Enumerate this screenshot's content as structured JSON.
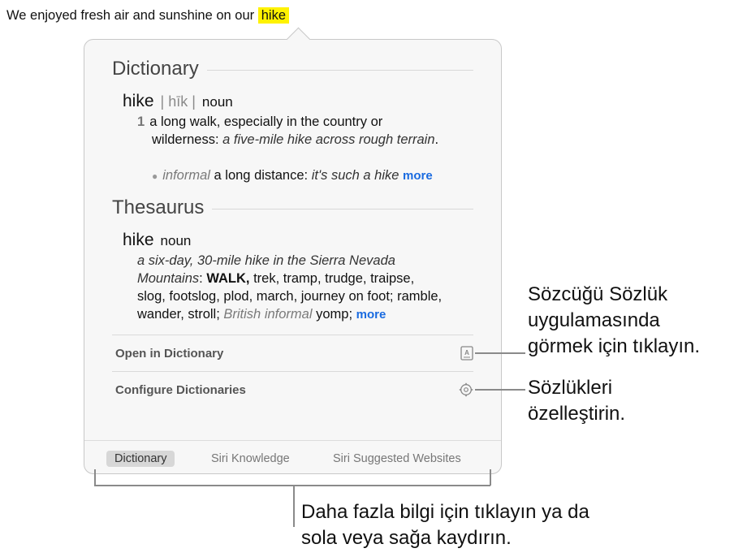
{
  "sentence": {
    "prefix": "We enjoyed fresh air and sunshine on our",
    "highlighted": "hike"
  },
  "dictionary": {
    "section_title": "Dictionary",
    "headword": "hike",
    "pronunciation": "| hīk |",
    "part_of_speech": "noun",
    "sense_number": "1",
    "definition": "a long walk, especially in the country or wilderness:",
    "example": "a five-mile hike across rough terrain",
    "period": ".",
    "sub_label": "informal",
    "sub_definition": "a long distance:",
    "sub_example": "it's such a hike",
    "more_label": "more"
  },
  "thesaurus": {
    "section_title": "Thesaurus",
    "headword": "hike",
    "part_of_speech": "noun",
    "example": "a six-day, 30-mile hike in the Sierra Nevada Mountains",
    "colon": ":",
    "first_synonym": "WALK,",
    "synonyms": "trek, tramp, trudge, traipse, slog, footslog, plod, march, journey on foot; ramble, wander, stroll;",
    "register_label": "British informal",
    "register_word": "yomp;",
    "more_label": "more"
  },
  "actions": {
    "open_label": "Open in Dictionary",
    "configure_label": "Configure Dictionaries"
  },
  "tabs": {
    "dictionary": "Dictionary",
    "siri_knowledge": "Siri Knowledge",
    "siri_websites": "Siri Suggested Websites"
  },
  "callouts": {
    "open_line1": "Sözcüğü Sözlük",
    "open_line2": "uygulamasında",
    "open_line3": "görmek için tıklayın.",
    "config_line1": "Sözlükleri",
    "config_line2": "özelleştirin.",
    "tabs_line1": "Daha fazla bilgi için tıklayın ya da",
    "tabs_line2": "sola veya sağa kaydırın."
  }
}
